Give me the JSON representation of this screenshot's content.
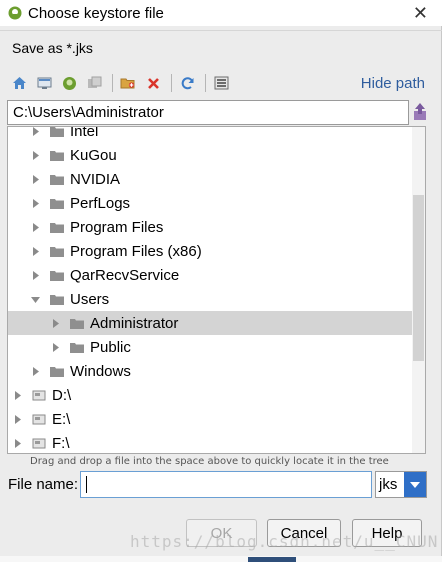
{
  "window": {
    "title": "Choose keystore file",
    "subtitle": "Save as *.jks",
    "close_glyph": "✕"
  },
  "toolbar": {
    "icons": [
      "home-icon",
      "desktop-icon",
      "android-project-icon",
      "module-icon",
      "new-folder-icon",
      "delete-icon",
      "refresh-icon",
      "show-hidden-icon"
    ],
    "hide_path_label": "Hide path"
  },
  "path": {
    "value": "C:\\Users\\Administrator"
  },
  "tree": {
    "rows": [
      {
        "label": "Intel",
        "level": 1,
        "expanded": false,
        "type": "folder"
      },
      {
        "label": "KuGou",
        "level": 1,
        "expanded": false,
        "type": "folder"
      },
      {
        "label": "NVIDIA",
        "level": 1,
        "expanded": false,
        "type": "folder"
      },
      {
        "label": "PerfLogs",
        "level": 1,
        "expanded": false,
        "type": "folder"
      },
      {
        "label": "Program Files",
        "level": 1,
        "expanded": false,
        "type": "folder"
      },
      {
        "label": "Program Files (x86)",
        "level": 1,
        "expanded": false,
        "type": "folder"
      },
      {
        "label": "QarRecvService",
        "level": 1,
        "expanded": false,
        "type": "folder"
      },
      {
        "label": "Users",
        "level": 1,
        "expanded": true,
        "type": "folder"
      },
      {
        "label": "Administrator",
        "level": 2,
        "expanded": false,
        "type": "folder",
        "selected": true
      },
      {
        "label": "Public",
        "level": 2,
        "expanded": false,
        "type": "folder"
      },
      {
        "label": "Windows",
        "level": 1,
        "expanded": false,
        "type": "folder"
      },
      {
        "label": "D:\\",
        "level": 0,
        "expanded": false,
        "type": "drive"
      },
      {
        "label": "E:\\",
        "level": 0,
        "expanded": false,
        "type": "drive"
      },
      {
        "label": "F:\\",
        "level": 0,
        "expanded": false,
        "type": "drive"
      }
    ]
  },
  "hint": "Drag and drop a file into the space above to quickly locate it in the tree",
  "file_name": {
    "label": "File name:",
    "value": "",
    "extension": "jks"
  },
  "buttons": {
    "ok": "OK",
    "cancel": "Cancel",
    "help": "Help"
  },
  "watermark": "https://blog.csdn.net/u__CNUN",
  "colors": {
    "accent": "#2f6fc7",
    "link": "#2f5d9e",
    "selection": "#d4d4d4",
    "delete": "#d9342b"
  }
}
